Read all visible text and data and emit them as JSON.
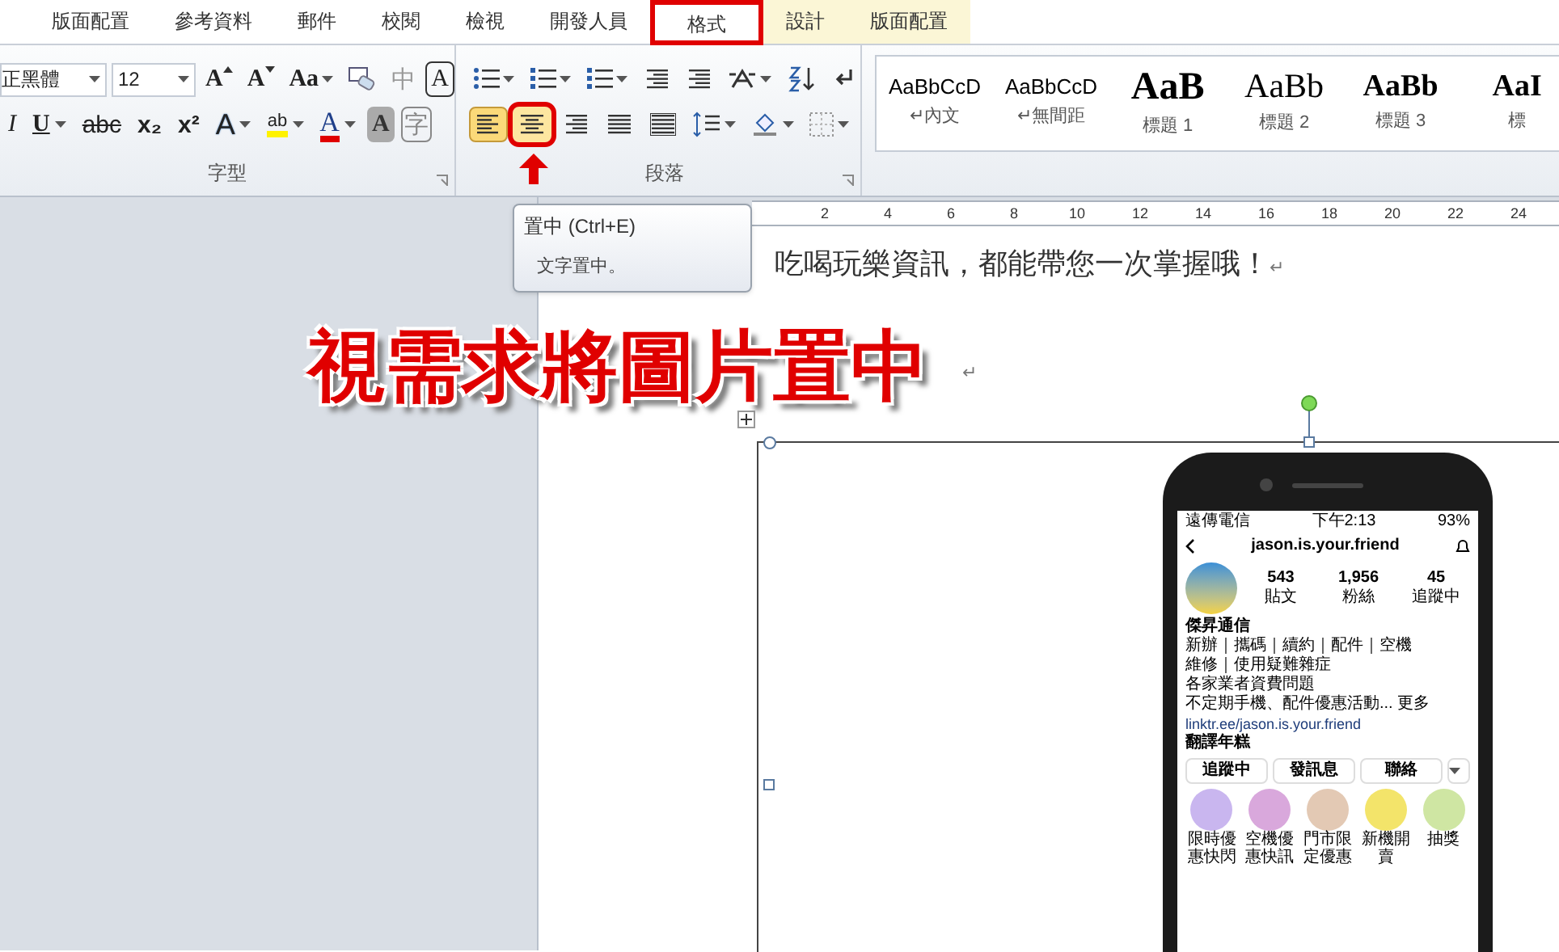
{
  "tabs": [
    {
      "label": "版面配置",
      "selected": false,
      "contextual": false,
      "annotated": false
    },
    {
      "label": "參考資料",
      "selected": false,
      "contextual": false,
      "annotated": false
    },
    {
      "label": "郵件",
      "selected": false,
      "contextual": false,
      "annotated": false
    },
    {
      "label": "校閱",
      "selected": false,
      "contextual": false,
      "annotated": false
    },
    {
      "label": "檢視",
      "selected": false,
      "contextual": false,
      "annotated": false
    },
    {
      "label": "開發人員",
      "selected": false,
      "contextual": false,
      "annotated": false
    },
    {
      "label": "格式",
      "selected": true,
      "contextual": false,
      "annotated": true
    },
    {
      "label": "設計",
      "selected": false,
      "contextual": true,
      "annotated": false
    },
    {
      "label": "版面配置",
      "selected": false,
      "contextual": true,
      "annotated": false
    }
  ],
  "font_group": {
    "label": "字型",
    "font_name": "正黑體",
    "font_size": "12",
    "row1": [
      {
        "label": "A",
        "kind": "grow"
      },
      {
        "label": "A",
        "kind": "shrink"
      },
      {
        "label": "Aa",
        "kind": "case"
      },
      {
        "label": "中",
        "kind": "phonetic"
      },
      {
        "label": "A",
        "kind": "boxed"
      }
    ],
    "row2": [
      {
        "label": "I",
        "kind": "italic"
      },
      {
        "label": "U",
        "kind": "underline"
      },
      {
        "label": "abc",
        "kind": "strike"
      },
      {
        "label": "x₂",
        "kind": "sub"
      },
      {
        "label": "x²",
        "kind": "sup"
      },
      {
        "label": "A",
        "kind": "effect"
      },
      {
        "label": "ab",
        "kind": "highlight"
      },
      {
        "label": "A",
        "kind": "color"
      },
      {
        "label": "A",
        "kind": "shaded"
      },
      {
        "label": "字",
        "kind": "circled"
      }
    ]
  },
  "paragraph_group": {
    "label": "段落",
    "alignment": [
      {
        "selected": true,
        "annotated": false
      },
      {
        "selected": false,
        "annotated": true
      },
      {
        "selected": false,
        "annotated": false
      },
      {
        "selected": false,
        "annotated": false
      },
      {
        "selected": false,
        "annotated": false
      }
    ]
  },
  "styles": [
    {
      "preview": "AaBbCcD",
      "name": "↵內文",
      "kind": "normal"
    },
    {
      "preview": "AaBbCcD",
      "name": "↵無間距",
      "kind": "normal"
    },
    {
      "preview": "AaB",
      "name": "標題 1",
      "kind": "heading1"
    },
    {
      "preview": "AaBb",
      "name": "標題 2",
      "kind": "heading2"
    },
    {
      "preview": "AaBb",
      "name": "標題 3",
      "kind": "heading3"
    },
    {
      "preview": "AaI",
      "name": "標",
      "kind": "heading3"
    }
  ],
  "tooltip": {
    "title": "置中 (Ctrl+E)",
    "body": "文字置中。"
  },
  "ruler": [
    "2",
    "4",
    "6",
    "8",
    "10",
    "12",
    "14",
    "16",
    "18",
    "20",
    "22",
    "24"
  ],
  "document": {
    "line": "吃喝玩樂資訊，都能帶您一次掌握哦！",
    "line_mark": "↵",
    "empty_mark": "↵"
  },
  "annotation": "視需求將圖片置中",
  "phone": {
    "carrier": "遠傳電信",
    "time": "下午2:13",
    "battery": "93%",
    "username": "jason.is.your.friend",
    "stats": [
      {
        "value": "543",
        "label": "貼文"
      },
      {
        "value": "1,956",
        "label": "粉絲"
      },
      {
        "value": "45",
        "label": "追蹤中"
      }
    ],
    "bio": [
      "傑昇通信",
      "新辦｜攜碼｜續約｜配件｜空機",
      "維修｜使用疑難雜症",
      "各家業者資費問題",
      "不定期手機、配件優惠活動... 更多"
    ],
    "link": "linktr.ee/jason.is.your.friend",
    "translate": "翻譯年糕",
    "buttons": [
      "追蹤中",
      "發訊息",
      "聯絡"
    ],
    "highlights": [
      {
        "label": "限時優惠快閃",
        "color": "#c9b6ef"
      },
      {
        "label": "空機優惠快訊",
        "color": "#d9a8dc"
      },
      {
        "label": "門市限定優惠",
        "color": "#e3c9b4"
      },
      {
        "label": "新機開賣",
        "color": "#f3e46a"
      },
      {
        "label": "抽獎",
        "color": "#cfe6a3"
      }
    ]
  }
}
